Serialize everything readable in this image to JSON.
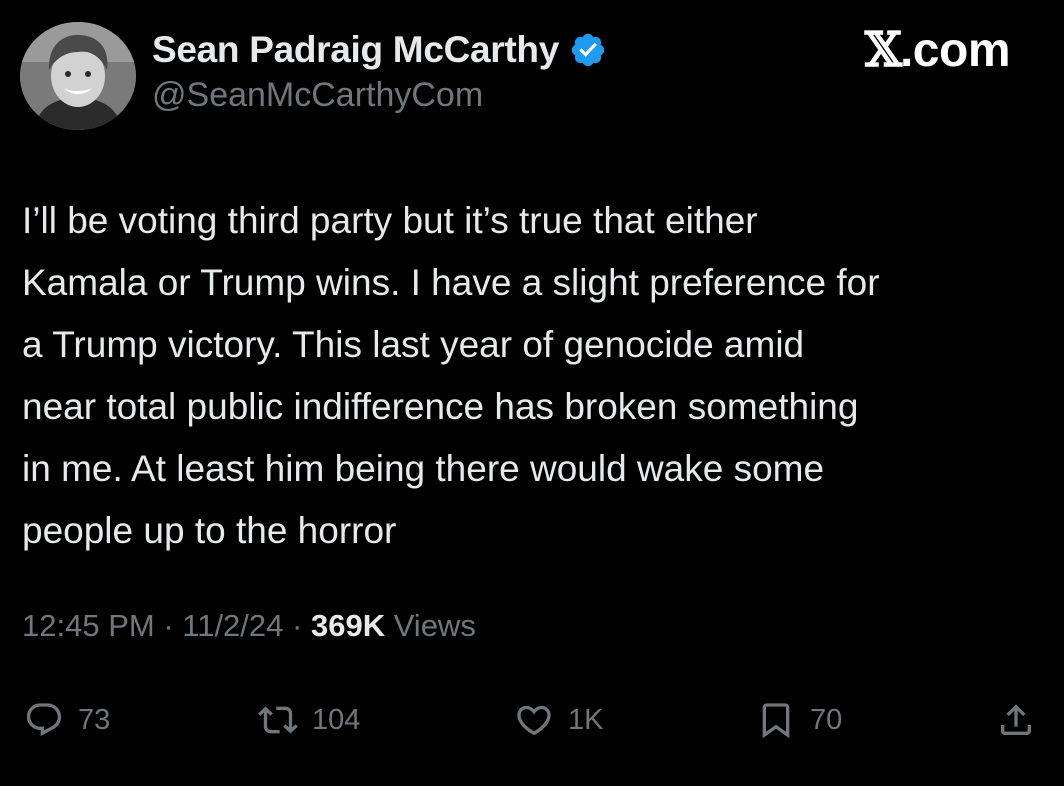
{
  "author": {
    "display_name": "Sean Padraig McCarthy",
    "handle": "@SeanMcCarthyCom",
    "verified": true
  },
  "brand": {
    "x": "𝕏",
    "suffix": ".com"
  },
  "tweet": {
    "lines": [
      "I’ll be voting third party but it’s true that either",
      "Kamala or Trump wins. I have a slight preference for",
      "a Trump victory. This last year of genocide amid",
      "near total public indifference has broken something",
      "in me. At least him being there would wake some",
      "people up to the horror"
    ],
    "time": "12:45 PM",
    "separator": " · ",
    "date": "11/2/24",
    "views_count": "369K",
    "views_label": " Views"
  },
  "actions": {
    "replies": "73",
    "reposts": "104",
    "likes": "1K",
    "bookmarks": "70"
  },
  "icons": {
    "reply": "reply-icon",
    "repost": "repost-icon",
    "like": "heart-icon",
    "bookmark": "bookmark-icon",
    "share": "share-icon",
    "verified": "verified-badge-icon"
  },
  "colors": {
    "background": "#000000",
    "primary_text": "#e7e9ea",
    "secondary_text": "#71767b",
    "verified_blue": "#1d9bf0"
  }
}
